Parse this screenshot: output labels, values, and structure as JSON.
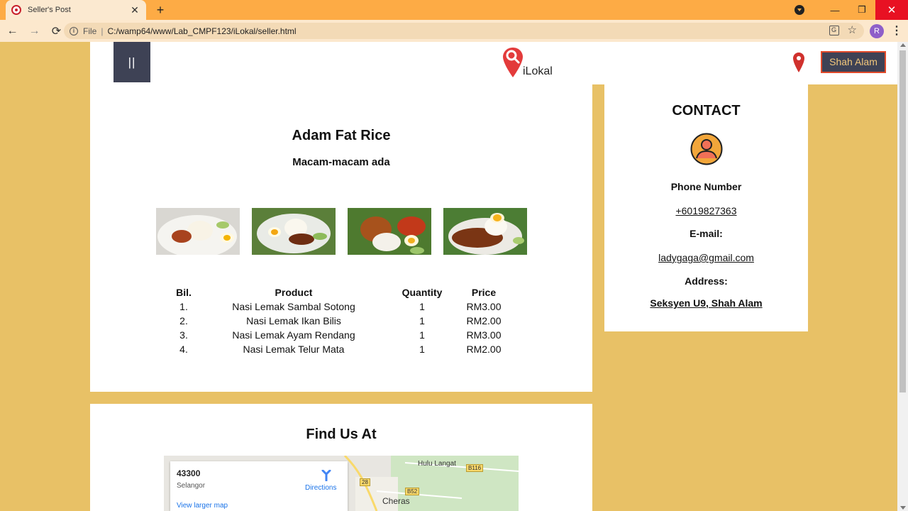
{
  "browser": {
    "tab_title": "Seller's Post",
    "tab_close": "✕",
    "new_tab": "+",
    "scheme": "File",
    "separator": "|",
    "url": "C:/wamp64/www/Lab_CMPF123/iLokal/seller.html",
    "profile_initial": "R",
    "nav": {
      "back": "←",
      "forward": "→",
      "reload": "⟳"
    },
    "window": {
      "minimize": "—",
      "maximize": "❐",
      "close": "✕"
    },
    "menu": "⋮",
    "star": "☆",
    "translate": "G",
    "info": "i"
  },
  "header": {
    "menu_icon": "||",
    "logo_text": "iLokal",
    "city_button": "Shah Alam",
    "accent": "#3e4255",
    "pin_color": "#d0312d"
  },
  "shop": {
    "title": "Adam Fat Rice",
    "tagline": "Macam-macam ada",
    "photos": [
      "nasi-lemak-photo",
      "nasi-lemak-photo",
      "nasi-lemak-photo",
      "nasi-lemak-photo"
    ],
    "table": {
      "headers": [
        "Bil.",
        "Product",
        "Quantity",
        "Price"
      ],
      "rows": [
        [
          "1.",
          "Nasi Lemak Sambal Sotong",
          "1",
          "RM3.00"
        ],
        [
          "2.",
          "Nasi Lemak Ikan Bilis",
          "1",
          "RM2.00"
        ],
        [
          "3.",
          "Nasi Lemak Ayam Rendang",
          "1",
          "RM3.00"
        ],
        [
          "4.",
          "Nasi Lemak Telur Mata",
          "1",
          "RM2.00"
        ]
      ]
    }
  },
  "contact": {
    "title": "CONTACT",
    "phone_label": "Phone Number",
    "phone": "+6019827363",
    "email_label": "E-mail:",
    "email": "ladygaga@gmail.com",
    "address_label": "Address:",
    "address": "Seksyen U9, Shah Alam"
  },
  "find": {
    "title": "Find Us At",
    "map": {
      "postcode": "43300",
      "state": "Selangor",
      "directions": "Directions",
      "larger_map": "View larger map",
      "places": [
        "Hulu Langat",
        "Cheras"
      ],
      "roads": [
        "B116",
        "28",
        "B52"
      ]
    }
  },
  "colors": {
    "page_bg": "#e8c166",
    "tab_bar": "#fdab45",
    "link": "#1a73e8"
  }
}
